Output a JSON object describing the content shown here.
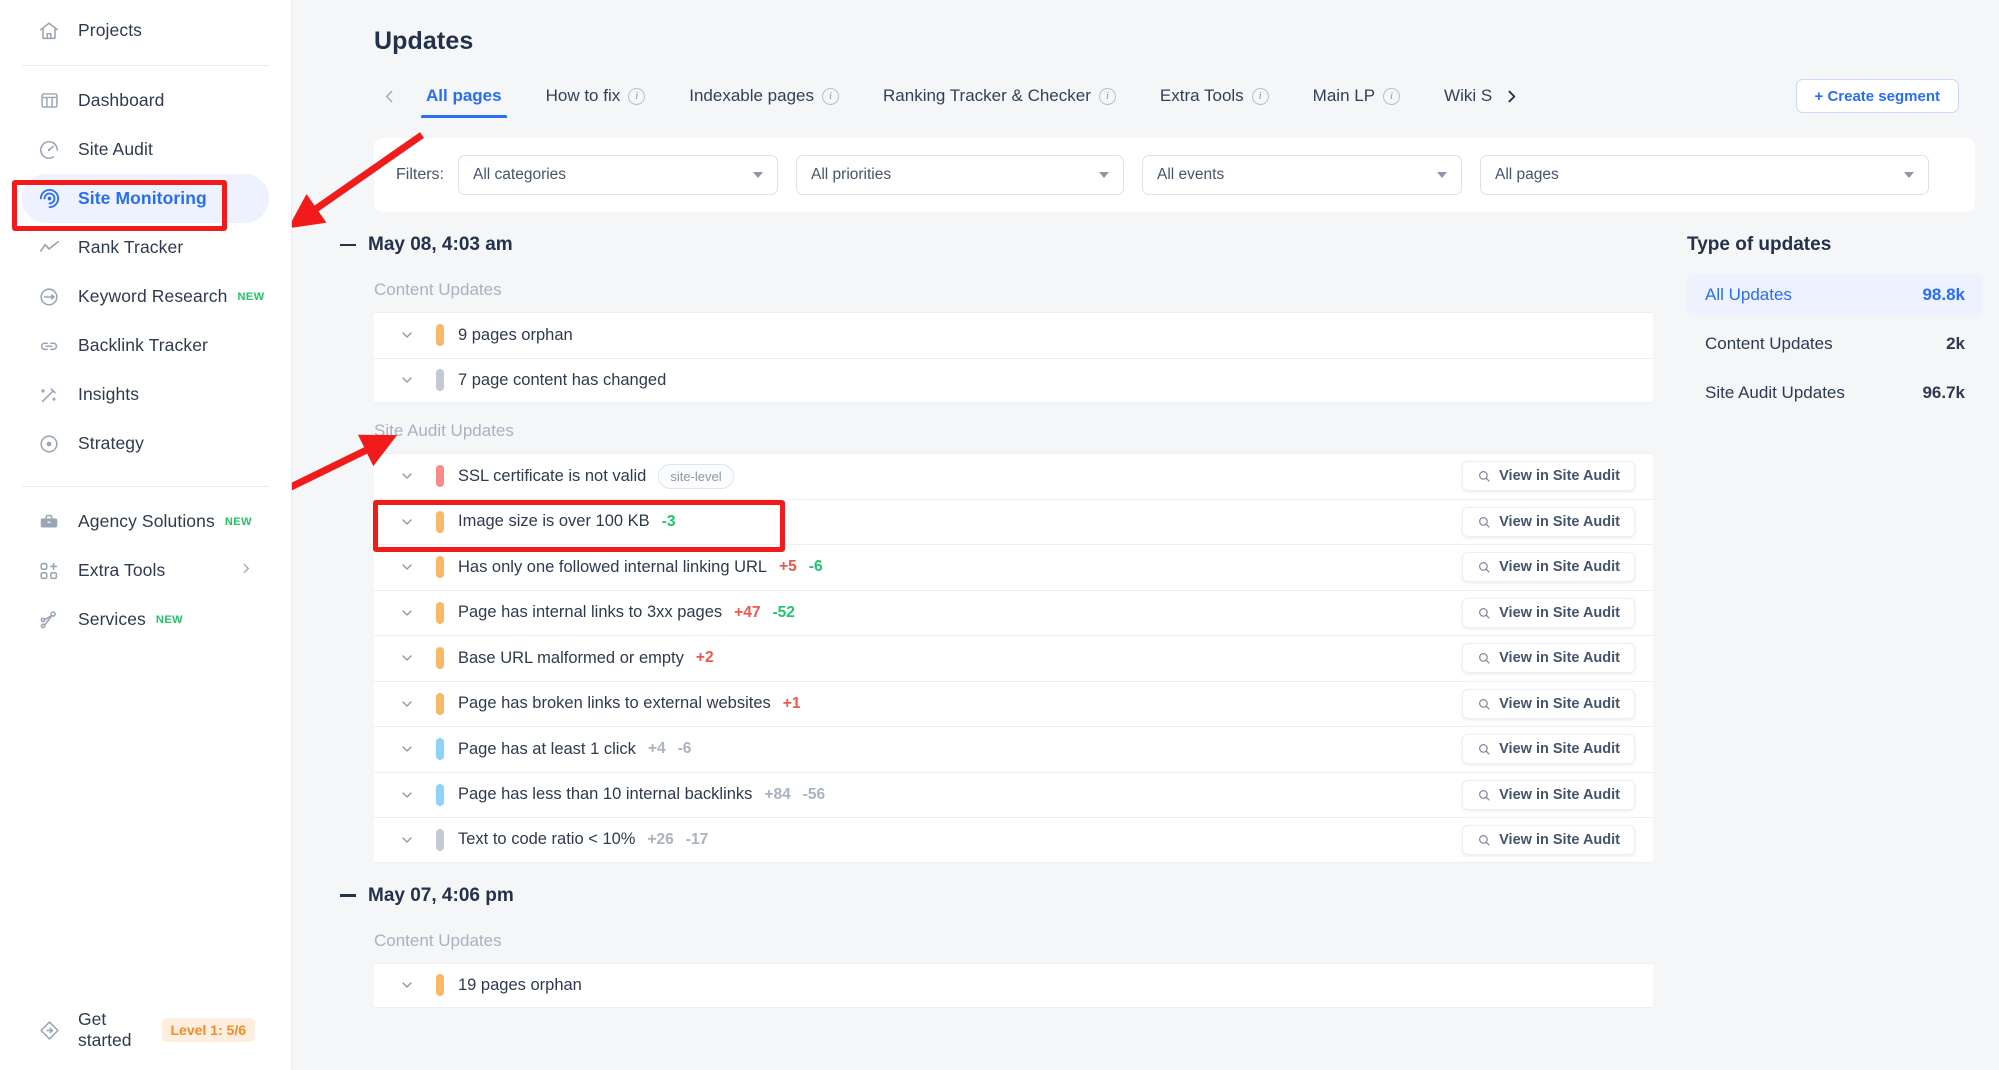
{
  "sidebar": {
    "top": [
      {
        "label": "Projects",
        "icon": "home-icon"
      }
    ],
    "items": [
      {
        "label": "Dashboard",
        "icon": "dashboard-icon"
      },
      {
        "label": "Site Audit",
        "icon": "gauge-icon"
      },
      {
        "label": "Site Monitoring",
        "icon": "radar-icon",
        "active": true
      },
      {
        "label": "Rank Tracker",
        "icon": "chart-line-icon"
      },
      {
        "label": "Keyword Research",
        "icon": "target-arrow-icon",
        "badge": "NEW"
      },
      {
        "label": "Backlink Tracker",
        "icon": "link-icon"
      },
      {
        "label": "Insights",
        "icon": "magic-wand-icon"
      },
      {
        "label": "Strategy",
        "icon": "bullseye-icon"
      }
    ],
    "bottom": [
      {
        "label": "Agency Solutions",
        "icon": "briefcase-icon",
        "badge": "NEW"
      },
      {
        "label": "Extra Tools",
        "icon": "grid-plus-icon",
        "chevron": true
      },
      {
        "label": "Services",
        "icon": "node-tree-icon",
        "badge": "NEW"
      }
    ],
    "get_started": {
      "label": "Get started",
      "icon": "rocket-badge-icon",
      "level": "Level 1: 5/6"
    }
  },
  "header": {
    "title": "Updates"
  },
  "tabs": {
    "prev_icon": "chevron-left-icon",
    "next_icon": "chevron-right-icon",
    "items": [
      {
        "label": "All pages",
        "active": true,
        "info": false
      },
      {
        "label": "How to fix",
        "active": false,
        "info": true
      },
      {
        "label": "Indexable pages",
        "active": false,
        "info": true
      },
      {
        "label": "Ranking Tracker & Checker",
        "active": false,
        "info": true
      },
      {
        "label": "Extra Tools",
        "active": false,
        "info": true
      },
      {
        "label": "Main LP",
        "active": false,
        "info": true
      },
      {
        "label": "Wiki S",
        "active": false,
        "info": false
      }
    ],
    "create_segment": "+  Create segment"
  },
  "filters": {
    "label": "Filters:",
    "selects": [
      {
        "value": "All categories",
        "name": "categories-select"
      },
      {
        "value": "All priorities",
        "name": "priorities-select"
      },
      {
        "value": "All events",
        "name": "events-select"
      },
      {
        "value": "All pages",
        "name": "pages-select"
      }
    ]
  },
  "days": [
    {
      "date": "May 08, 4:03 am",
      "sections": [
        {
          "title": "Content Updates",
          "rows": [
            {
              "text": "9 pages orphan",
              "priority": "#f8b866",
              "deltas": [],
              "tag": null,
              "action": null
            },
            {
              "text": "7 page content has changed",
              "priority": "#c3cad5",
              "deltas": [],
              "tag": null,
              "action": null
            }
          ]
        },
        {
          "title": "Site Audit Updates",
          "rows": [
            {
              "text": "SSL certificate is not valid",
              "priority": "#f98a85",
              "tag": "site-level",
              "deltas": [],
              "action": "View in Site Audit"
            },
            {
              "text": "Image size is over 100 KB",
              "priority": "#f8b866",
              "tag": null,
              "deltas": [
                {
                  "v": "-3",
                  "k": "down"
                }
              ],
              "action": "View in Site Audit"
            },
            {
              "text": "Has only one followed internal linking URL",
              "priority": "#f8b866",
              "tag": null,
              "deltas": [
                {
                  "v": "+5",
                  "k": "up"
                },
                {
                  "v": "-6",
                  "k": "down"
                }
              ],
              "action": "View in Site Audit"
            },
            {
              "text": "Page has internal links to 3xx pages",
              "priority": "#f8b866",
              "tag": null,
              "deltas": [
                {
                  "v": "+47",
                  "k": "up"
                },
                {
                  "v": "-52",
                  "k": "down"
                }
              ],
              "action": "View in Site Audit"
            },
            {
              "text": "Base URL malformed or empty",
              "priority": "#f8b866",
              "tag": null,
              "deltas": [
                {
                  "v": "+2",
                  "k": "up"
                }
              ],
              "action": "View in Site Audit"
            },
            {
              "text": "Page has broken links to external websites",
              "priority": "#f8b866",
              "tag": null,
              "deltas": [
                {
                  "v": "+1",
                  "k": "up"
                }
              ],
              "action": "View in Site Audit"
            },
            {
              "text": "Page has at least 1 click",
              "priority": "#8ed2f8",
              "tag": null,
              "deltas": [
                {
                  "v": "+4",
                  "k": "mute"
                },
                {
                  "v": "-6",
                  "k": "mute"
                }
              ],
              "action": "View in Site Audit"
            },
            {
              "text": "Page has less than 10 internal backlinks",
              "priority": "#8ed2f8",
              "tag": null,
              "deltas": [
                {
                  "v": "+84",
                  "k": "mute"
                },
                {
                  "v": "-56",
                  "k": "mute"
                }
              ],
              "action": "View in Site Audit"
            },
            {
              "text": "Text to code ratio < 10%",
              "priority": "#c3cad5",
              "tag": null,
              "deltas": [
                {
                  "v": "+26",
                  "k": "mute"
                },
                {
                  "v": "-17",
                  "k": "mute"
                }
              ],
              "action": "View in Site Audit"
            }
          ]
        }
      ]
    },
    {
      "date": "May 07, 4:06 pm",
      "sections": [
        {
          "title": "Content Updates",
          "rows": [
            {
              "text": "19 pages orphan",
              "priority": "#f8b866",
              "deltas": [],
              "tag": null,
              "action": null
            }
          ]
        }
      ]
    }
  ],
  "side_panel": {
    "title": "Type of updates",
    "items": [
      {
        "label": "All Updates",
        "value": "98.8k",
        "active": true
      },
      {
        "label": "Content Updates",
        "value": "2k",
        "active": false
      },
      {
        "label": "Site Audit Updates",
        "value": "96.7k",
        "active": false
      }
    ]
  },
  "annotations": {
    "accent": "#f21b1b",
    "highlight_sidebar_item": "Site Monitoring",
    "highlight_row": "SSL certificate is not valid"
  },
  "colors": {
    "brand_blue": "#2a6df5",
    "text_dark": "#23324a",
    "muted": "#a9b2c1",
    "up_red": "#f4554a",
    "down_green": "#1ec56a",
    "annotation_red": "#f21b1b"
  }
}
